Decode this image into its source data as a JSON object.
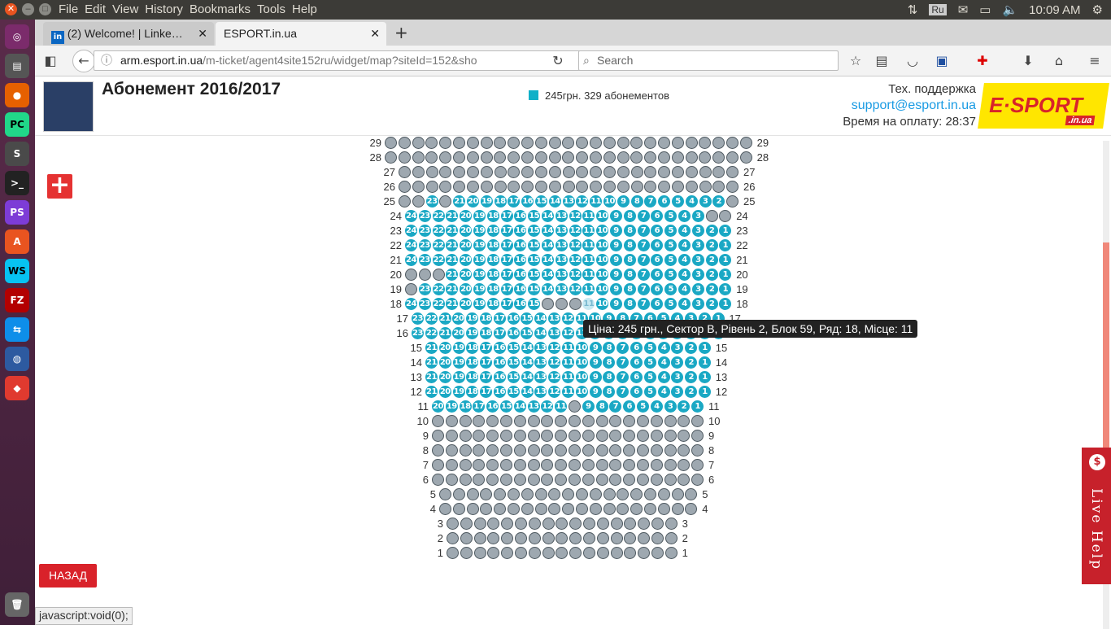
{
  "topbar": {
    "menus": [
      "File",
      "Edit",
      "View",
      "History",
      "Bookmarks",
      "Tools",
      "Help"
    ],
    "keyboard": "Ru",
    "time": "10:09 AM"
  },
  "tabs": [
    {
      "label": "(2) Welcome! | Linke…",
      "active": false
    },
    {
      "label": "ESPORT.in.ua",
      "active": true
    }
  ],
  "nav": {
    "url_host": "arm.esport.in.ua",
    "url_path": "/m-ticket/agent4site152ru/widget/map?siteId=152&sho",
    "search_placeholder": "Search"
  },
  "header": {
    "title": "Абонемент 2016/2017",
    "legend": "245грн. 329 абонементов",
    "support_label": "Тех. поддержка",
    "support_email": "support@esport.in.ua",
    "timer": "Время на оплату: 28:37",
    "logo_text": "E·SPORT",
    "logo_sub": ".in.ua"
  },
  "zoom_button": "+",
  "tooltip": "Ціна: 245 грн., Сектор B, Рівень 2, Блок 59, Ряд: 18, Місце: 11",
  "back_button": "НАЗАД",
  "live_help": "Live Help",
  "status_text": "javascript:void(0);",
  "colors": {
    "available": "#1aa8c4",
    "taken": "#9ea8b0",
    "accent": "#d9222a"
  },
  "seatmap": {
    "rows": [
      {
        "row": 29,
        "start": 473,
        "count": 27,
        "type": "gray"
      },
      {
        "row": 28,
        "start": 473,
        "count": 27,
        "type": "gray"
      },
      {
        "row": 27,
        "start": 490,
        "count": 25,
        "type": "gray"
      },
      {
        "row": 26,
        "start": 490,
        "count": 25,
        "type": "gray"
      },
      {
        "row": 25,
        "start": 490,
        "count": 25,
        "type": "mix25"
      },
      {
        "row": 24,
        "start": 498,
        "count": 24,
        "type": "mix24"
      },
      {
        "row": 23,
        "start": 498,
        "count": 24,
        "type": "num"
      },
      {
        "row": 22,
        "start": 498,
        "count": 24,
        "type": "num"
      },
      {
        "row": 21,
        "start": 498,
        "count": 24,
        "type": "num"
      },
      {
        "row": 20,
        "start": 498,
        "count": 24,
        "type": "mix20"
      },
      {
        "row": 19,
        "start": 498,
        "count": 24,
        "type": "mix19"
      },
      {
        "row": 18,
        "start": 498,
        "count": 24,
        "type": "mix18"
      },
      {
        "row": 17,
        "start": 506,
        "count": 23,
        "type": "num"
      },
      {
        "row": 16,
        "start": 506,
        "count": 23,
        "type": "num"
      },
      {
        "row": 15,
        "start": 523,
        "count": 21,
        "type": "num"
      },
      {
        "row": 14,
        "start": 523,
        "count": 21,
        "type": "num"
      },
      {
        "row": 13,
        "start": 523,
        "count": 21,
        "type": "num"
      },
      {
        "row": 12,
        "start": 523,
        "count": 21,
        "type": "num"
      },
      {
        "row": 11,
        "start": 531,
        "count": 20,
        "type": "mix11"
      },
      {
        "row": 10,
        "start": 531,
        "count": 20,
        "type": "gray"
      },
      {
        "row": 9,
        "start": 531,
        "count": 20,
        "type": "gray"
      },
      {
        "row": 8,
        "start": 531,
        "count": 20,
        "type": "gray"
      },
      {
        "row": 7,
        "start": 531,
        "count": 20,
        "type": "gray"
      },
      {
        "row": 6,
        "start": 531,
        "count": 20,
        "type": "gray"
      },
      {
        "row": 5,
        "start": 540,
        "count": 19,
        "type": "gray"
      },
      {
        "row": 4,
        "start": 540,
        "count": 19,
        "type": "gray"
      },
      {
        "row": 3,
        "start": 549,
        "count": 17,
        "type": "gray"
      },
      {
        "row": 2,
        "start": 549,
        "count": 17,
        "type": "gray"
      },
      {
        "row": 1,
        "start": 549,
        "count": 17,
        "type": "gray"
      }
    ]
  }
}
